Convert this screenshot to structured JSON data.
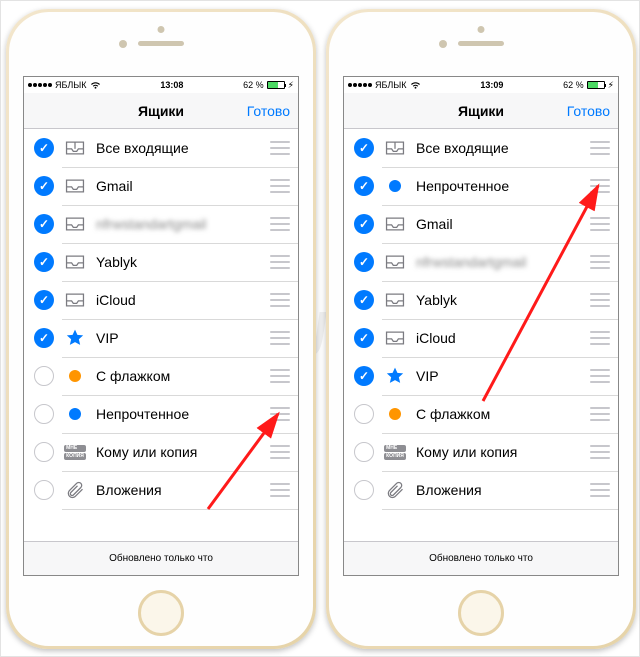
{
  "watermark_text": "блык",
  "phones": [
    {
      "status": {
        "carrier": "ЯБЛЫК",
        "time": "13:08",
        "battery_pct": "62 %",
        "battery_fill": 62
      },
      "nav": {
        "title": "Ящики",
        "done": "Готово"
      },
      "rows": [
        {
          "checked": true,
          "icon": "inbox",
          "label": "Все входящие",
          "blurred": false
        },
        {
          "checked": true,
          "icon": "tray",
          "label": "Gmail",
          "blurred": false
        },
        {
          "checked": true,
          "icon": "tray",
          "label": "nfrwstandartgmail",
          "blurred": true
        },
        {
          "checked": true,
          "icon": "tray",
          "label": "Yablyk",
          "blurred": false
        },
        {
          "checked": true,
          "icon": "tray",
          "label": "iCloud",
          "blurred": false
        },
        {
          "checked": true,
          "icon": "star",
          "label": "VIP",
          "blurred": false
        },
        {
          "checked": false,
          "icon": "flag",
          "label": "С флажком",
          "blurred": false
        },
        {
          "checked": false,
          "icon": "unread",
          "label": "Непрочтенное",
          "blurred": false
        },
        {
          "checked": false,
          "icon": "tocc",
          "label": "Кому или копия",
          "blurred": false
        },
        {
          "checked": false,
          "icon": "clip",
          "label": "Вложения",
          "blurred": false
        }
      ],
      "toolbar": "Обновлено только что",
      "arrow_target_row": 7
    },
    {
      "status": {
        "carrier": "ЯБЛЫК",
        "time": "13:09",
        "battery_pct": "62 %",
        "battery_fill": 62
      },
      "nav": {
        "title": "Ящики",
        "done": "Готово"
      },
      "rows": [
        {
          "checked": true,
          "icon": "inbox",
          "label": "Все входящие",
          "blurred": false
        },
        {
          "checked": true,
          "icon": "unread",
          "label": "Непрочтенное",
          "blurred": false
        },
        {
          "checked": true,
          "icon": "tray",
          "label": "Gmail",
          "blurred": false
        },
        {
          "checked": true,
          "icon": "tray",
          "label": "nfrwstandartgmail",
          "blurred": true
        },
        {
          "checked": true,
          "icon": "tray",
          "label": "Yablyk",
          "blurred": false
        },
        {
          "checked": true,
          "icon": "tray",
          "label": "iCloud",
          "blurred": false
        },
        {
          "checked": true,
          "icon": "star",
          "label": "VIP",
          "blurred": false
        },
        {
          "checked": false,
          "icon": "flag",
          "label": "С флажком",
          "blurred": false
        },
        {
          "checked": false,
          "icon": "tocc",
          "label": "Кому или копия",
          "blurred": false
        },
        {
          "checked": false,
          "icon": "clip",
          "label": "Вложения",
          "blurred": false
        }
      ],
      "toolbar": "Обновлено только что",
      "arrow_target_row": 1
    }
  ],
  "icon_labels": {
    "mne": "МНЕ",
    "kopia": "КОПИЯ"
  }
}
